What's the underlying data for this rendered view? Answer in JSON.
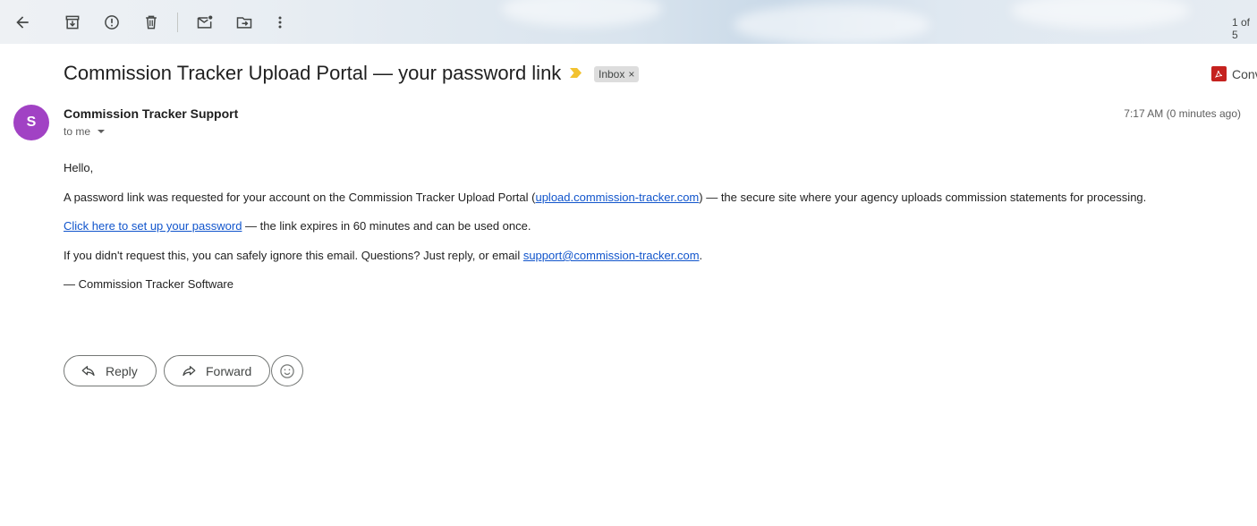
{
  "toolbar": {
    "pager_text": "1 of 5",
    "icons": [
      "back-arrow-icon",
      "archive-icon",
      "report-spam-icon",
      "delete-icon",
      "mark-unread-icon",
      "move-to-icon",
      "more-vert-icon"
    ]
  },
  "email": {
    "subject": "Commission Tracker Upload Portal — your password link",
    "label": "Inbox",
    "label_remove": "×",
    "conversation_snippet": "Conv",
    "sender_initial": "S",
    "sender_name": "Commission Tracker Support",
    "recipient": "to me",
    "timestamp": "7:17 AM (0 minutes ago)",
    "greeting": "Hello,",
    "para1_before": "A password link was requested for your account on the Commission Tracker Upload Portal (",
    "para1_link": "upload.commission-tracker.com",
    "para1_after": ") — the secure site where your agency uploads commission statements for processing.",
    "para2_link": "Click here to set up your password",
    "para2_after": " — the link expires in 60 minutes and can be used once.",
    "para3_before": "If you didn't request this, you can safely ignore this email. Questions? Just reply, or email ",
    "para3_link": "support@commission-tracker.com",
    "para3_after": ".",
    "signoff": "— Commission Tracker Software"
  },
  "actions": {
    "reply_label": "Reply",
    "forward_label": "Forward"
  },
  "colors": {
    "avatar": "#a142c4",
    "link": "#1155cc",
    "importance_marker": "#f2c230",
    "pdf_icon": "#c5221f"
  }
}
